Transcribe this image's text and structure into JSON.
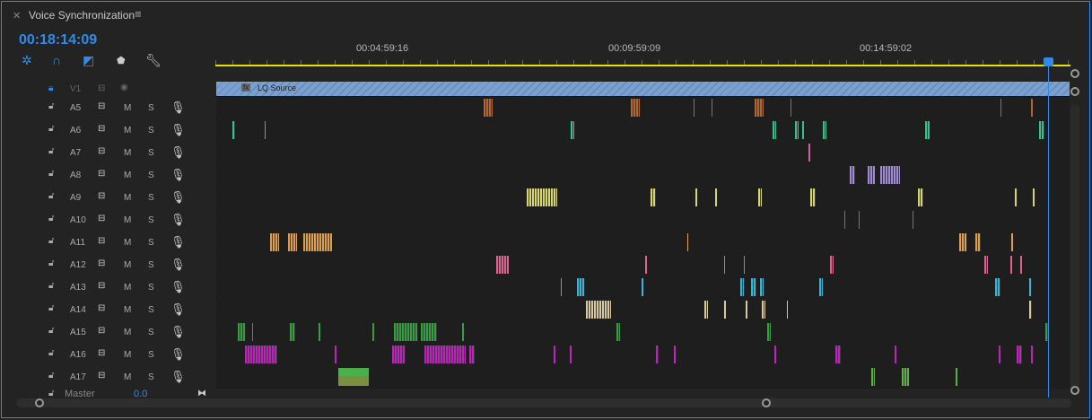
{
  "panel": {
    "title": "Voice Synchronization",
    "timecode": "00:18:14:09"
  },
  "icons": [
    "close-icon",
    "menu-icon",
    "snap-icon",
    "magnet-icon",
    "linked-selection-icon",
    "marker-icon",
    "wrench-icon"
  ],
  "ruler": {
    "labels": [
      "00:04:59:16",
      "00:09:59:09",
      "00:14:59:02"
    ]
  },
  "video_track": {
    "name": "V1",
    "clip_label": "LQ Source",
    "fx": "fx"
  },
  "audio_tracks": [
    {
      "name": "A5",
      "color": "#b5652a"
    },
    {
      "name": "A6",
      "color": "#2fc48c"
    },
    {
      "name": "A7",
      "color": "#d05fa8"
    },
    {
      "name": "A8",
      "color": "#a08ad8"
    },
    {
      "name": "A9",
      "color": "#d8d860"
    },
    {
      "name": "A10",
      "color": "#6a6ad0"
    },
    {
      "name": "A11",
      "color": "#e0a040"
    },
    {
      "name": "A12",
      "color": "#e06090"
    },
    {
      "name": "A13",
      "color": "#30b8d8"
    },
    {
      "name": "A14",
      "color": "#d8c8a0"
    },
    {
      "name": "A15",
      "color": "#30a040"
    },
    {
      "name": "A16",
      "color": "#c020c0"
    },
    {
      "name": "A17",
      "color": "#60b040"
    }
  ],
  "track_buttons": {
    "mute": "M",
    "solo": "S"
  },
  "master": {
    "label": "Master",
    "value": "0.0"
  }
}
